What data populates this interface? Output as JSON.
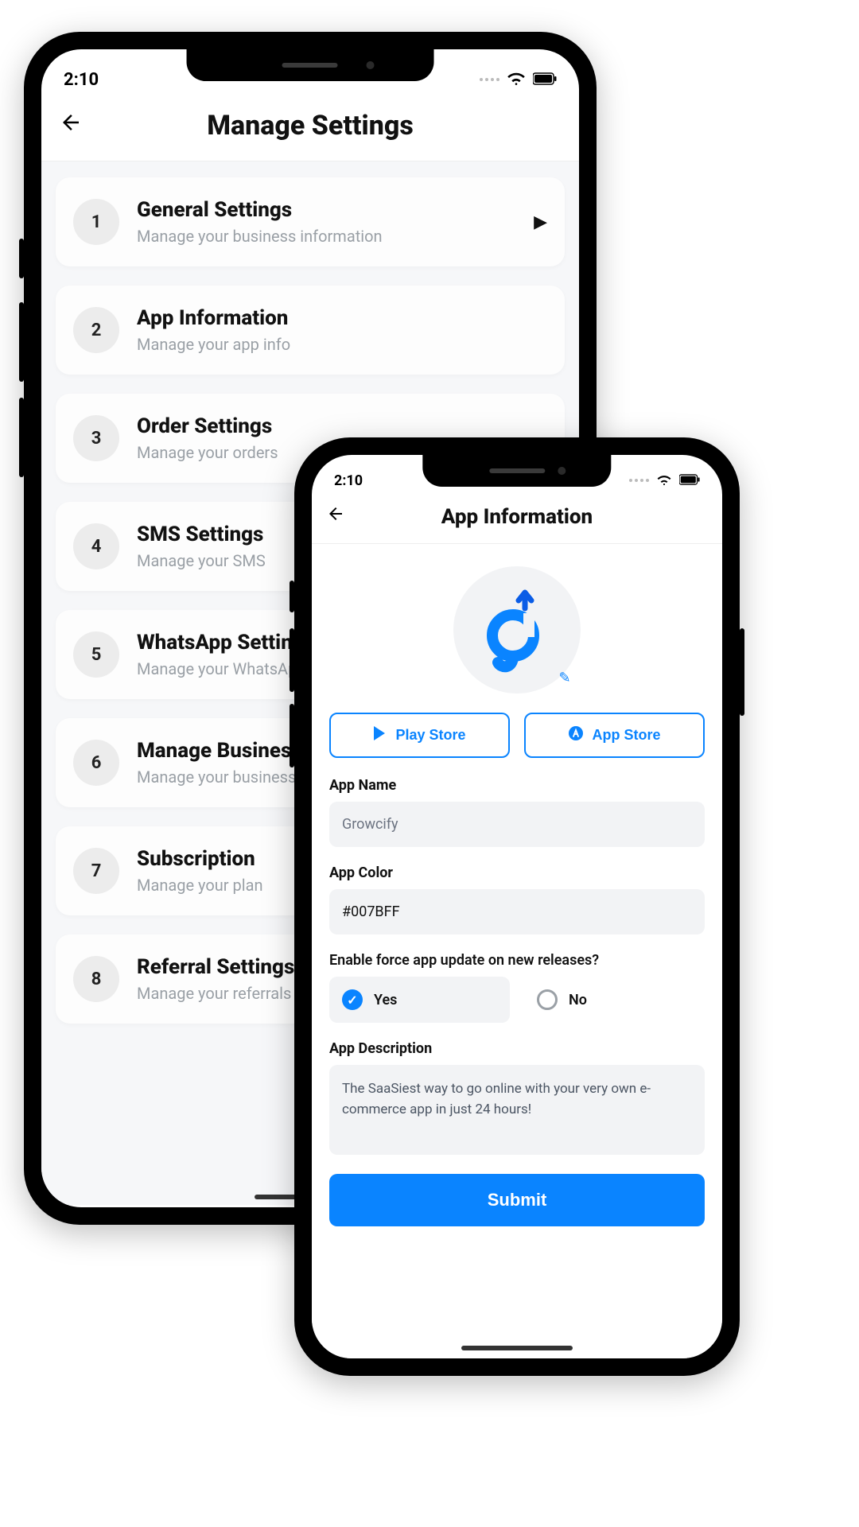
{
  "phone1": {
    "status": {
      "time": "2:10"
    },
    "header": {
      "title": "Manage Settings"
    },
    "items": [
      {
        "num": "1",
        "title": "General Settings",
        "sub": "Manage your business information"
      },
      {
        "num": "2",
        "title": "App Information",
        "sub": "Manage your app info"
      },
      {
        "num": "3",
        "title": "Order Settings",
        "sub": "Manage your orders"
      },
      {
        "num": "4",
        "title": "SMS Settings",
        "sub": "Manage your SMS"
      },
      {
        "num": "5",
        "title": "WhatsApp Settings",
        "sub": "Manage your WhatsApp"
      },
      {
        "num": "6",
        "title": "Manage Business",
        "sub": "Manage your business"
      },
      {
        "num": "7",
        "title": "Subscription",
        "sub": "Manage your plan"
      },
      {
        "num": "8",
        "title": "Referral Settings",
        "sub": "Manage your referrals"
      }
    ]
  },
  "phone2": {
    "status": {
      "time": "2:10"
    },
    "header": {
      "title": "App Information"
    },
    "store": {
      "play": "Play Store",
      "app": "App Store"
    },
    "fields": {
      "appname_label": "App Name",
      "appname_value": "Growcify",
      "appcolor_label": "App Color",
      "appcolor_value": "#007BFF",
      "forceupdate_label": "Enable force app update on new releases?",
      "yes": "Yes",
      "no": "No",
      "desc_label": "App Description",
      "desc_value": "The SaaSiest way to go online with your very own e-commerce app in just 24 hours!",
      "submit": "Submit"
    }
  }
}
